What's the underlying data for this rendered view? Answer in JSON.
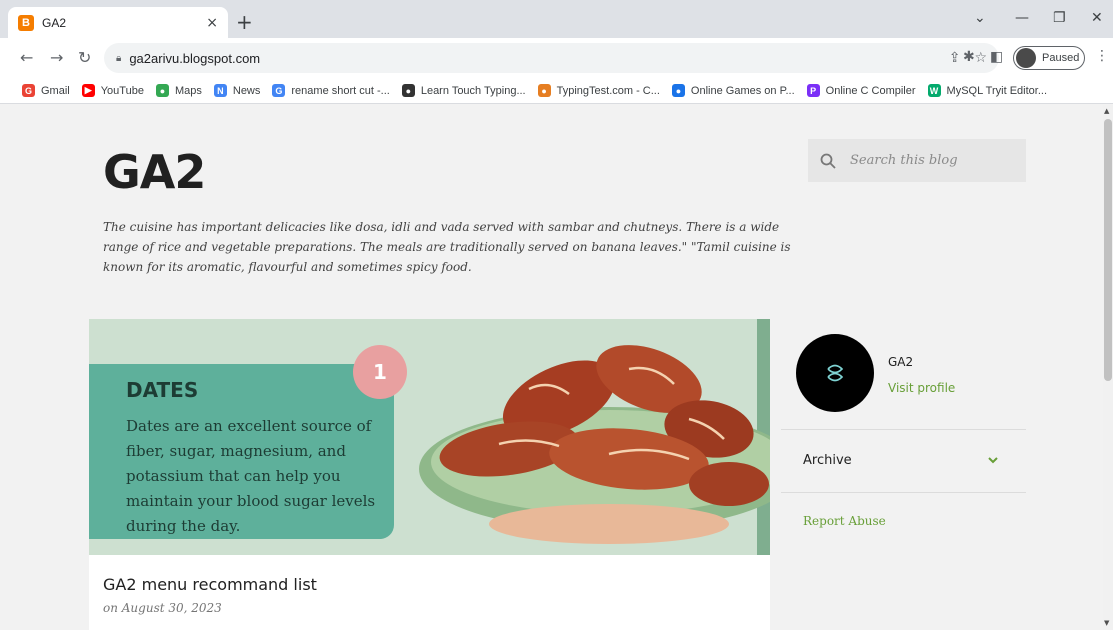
{
  "browser": {
    "tab_title": "GA2",
    "tab_favicon": "B",
    "new_tab": "+",
    "close": "×",
    "url": "ga2arivu.blogspot.com",
    "profile_status": "Paused",
    "bookmarks": [
      {
        "label": "Gmail",
        "icon": "G",
        "color": "#ea4335"
      },
      {
        "label": "YouTube",
        "icon": "▶",
        "color": "#ff0000"
      },
      {
        "label": "Maps",
        "icon": "●",
        "color": "#34a853"
      },
      {
        "label": "News",
        "icon": "N",
        "color": "#4285f4"
      },
      {
        "label": "rename short cut -...",
        "icon": "G",
        "color": "#4285f4"
      },
      {
        "label": "Learn Touch Typing...",
        "icon": "●",
        "color": "#333333"
      },
      {
        "label": "TypingTest.com - C...",
        "icon": "●",
        "color": "#e67e22"
      },
      {
        "label": "Online Games on P...",
        "icon": "●",
        "color": "#1a73e8"
      },
      {
        "label": "Online C Compiler",
        "icon": "P",
        "color": "#7b2ff7"
      },
      {
        "label": "MySQL Tryit Editor...",
        "icon": "W",
        "color": "#04aa6d"
      }
    ]
  },
  "blog": {
    "title": "GA2",
    "description": "The cuisine has important delicacies like dosa, idli and vada served with sambar and chutneys. There is a wide range of rice and vegetable preparations. The meals are traditionally served on banana leaves.\" \"Tamil cuisine is known for its aromatic, flavourful and sometimes spicy food.",
    "search_placeholder": "Search this blog"
  },
  "post": {
    "image": {
      "badge": "1",
      "heading": "DATES",
      "text": "Dates are an excellent source of fiber, sugar, magnesium, and potassium that can help you maintain your blood sugar levels during the day."
    },
    "title": "GA2 menu recommand list",
    "date": "on August 30, 2023"
  },
  "sidebar": {
    "profile_name": "GA2",
    "visit_profile": "Visit profile",
    "archive": "Archive",
    "report_abuse": "Report Abuse"
  },
  "colors": {
    "accent": "#689f38",
    "card": "#5eb09b"
  }
}
